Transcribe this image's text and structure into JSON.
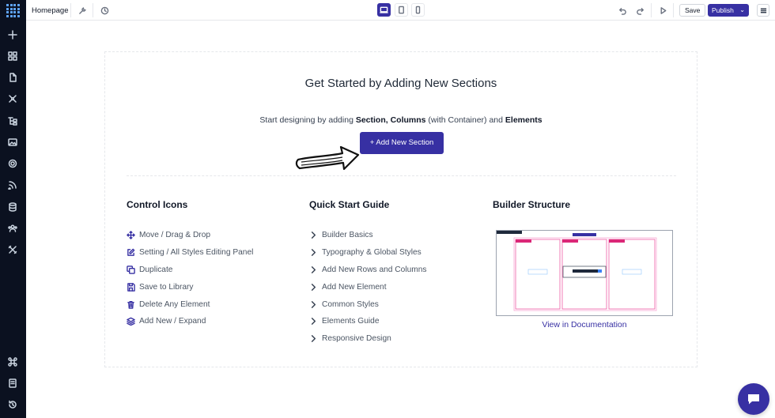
{
  "topbar": {
    "page_name": "Homepage",
    "save_label": "Save",
    "publish_label": "Publish"
  },
  "sidebar": {
    "items": [
      {
        "icon": "plus-icon"
      },
      {
        "icon": "grid-icon"
      },
      {
        "icon": "page-icon"
      },
      {
        "icon": "puzzle-icon"
      },
      {
        "icon": "layers-icon"
      },
      {
        "icon": "image-icon"
      },
      {
        "icon": "settings-icon"
      },
      {
        "icon": "rss-icon"
      },
      {
        "icon": "database-icon"
      },
      {
        "icon": "users-icon"
      },
      {
        "icon": "tools-icon"
      }
    ],
    "bottom": [
      {
        "icon": "command-icon"
      },
      {
        "icon": "book-icon"
      },
      {
        "icon": "history-icon"
      }
    ]
  },
  "canvas": {
    "title": "Get Started by Adding New Sections",
    "subtitle_prefix": "Start designing by adding ",
    "subtitle_bold1": "Section, Columns",
    "subtitle_mid": " (with Container) and ",
    "subtitle_bold2": "Elements",
    "add_section_label": "+ Add New Section"
  },
  "control_icons": {
    "title": "Control Icons",
    "items": [
      {
        "label": "Move / Drag & Drop",
        "icon": "move-icon"
      },
      {
        "label": "Setting / All Styles Editing Panel",
        "icon": "edit-icon"
      },
      {
        "label": "Duplicate",
        "icon": "copy-icon"
      },
      {
        "label": "Save to Library",
        "icon": "save-icon"
      },
      {
        "label": "Delete Any Element",
        "icon": "trash-icon"
      },
      {
        "label": "Add New / Expand",
        "icon": "stack-icon"
      }
    ]
  },
  "quick_start": {
    "title": "Quick Start Guide",
    "items": [
      "Builder Basics",
      "Typography & Global Styles",
      "Add New Rows and Columns",
      "Add New Element",
      "Common Styles",
      "Elements Guide",
      "Responsive Design"
    ]
  },
  "builder_structure": {
    "title": "Builder Structure",
    "link_label": "View in Documentation"
  },
  "colors": {
    "accent": "#3730a3",
    "sidebar_bg": "#0b1120"
  }
}
